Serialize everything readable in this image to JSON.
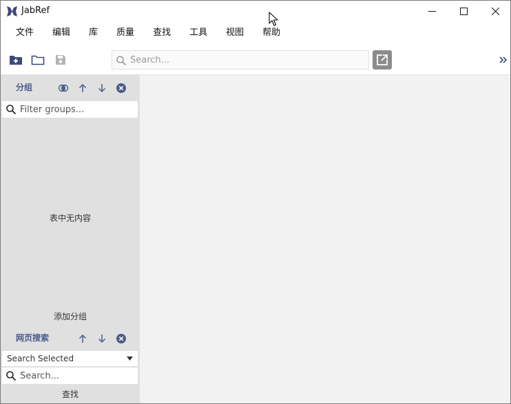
{
  "window": {
    "title": "JabRef",
    "accent_color": "#4a5a8c"
  },
  "menu": {
    "items": [
      "文件",
      "编辑",
      "库",
      "质量",
      "查找",
      "工具",
      "视图",
      "帮助"
    ]
  },
  "toolbar": {
    "search_placeholder": "Search...",
    "icons": [
      "new-library-icon",
      "open-library-icon",
      "save-library-icon",
      "global-search-icon",
      "overflow-chevron-icon"
    ]
  },
  "groups_panel": {
    "title": "分组",
    "filter_placeholder": "Filter groups...",
    "empty_message": "表中无内容",
    "add_group_label": "添加分组"
  },
  "web_search_panel": {
    "title": "网页搜索",
    "fetcher_selected": "Search Selected",
    "query_placeholder": "Search...",
    "fetch_label": "查找"
  }
}
